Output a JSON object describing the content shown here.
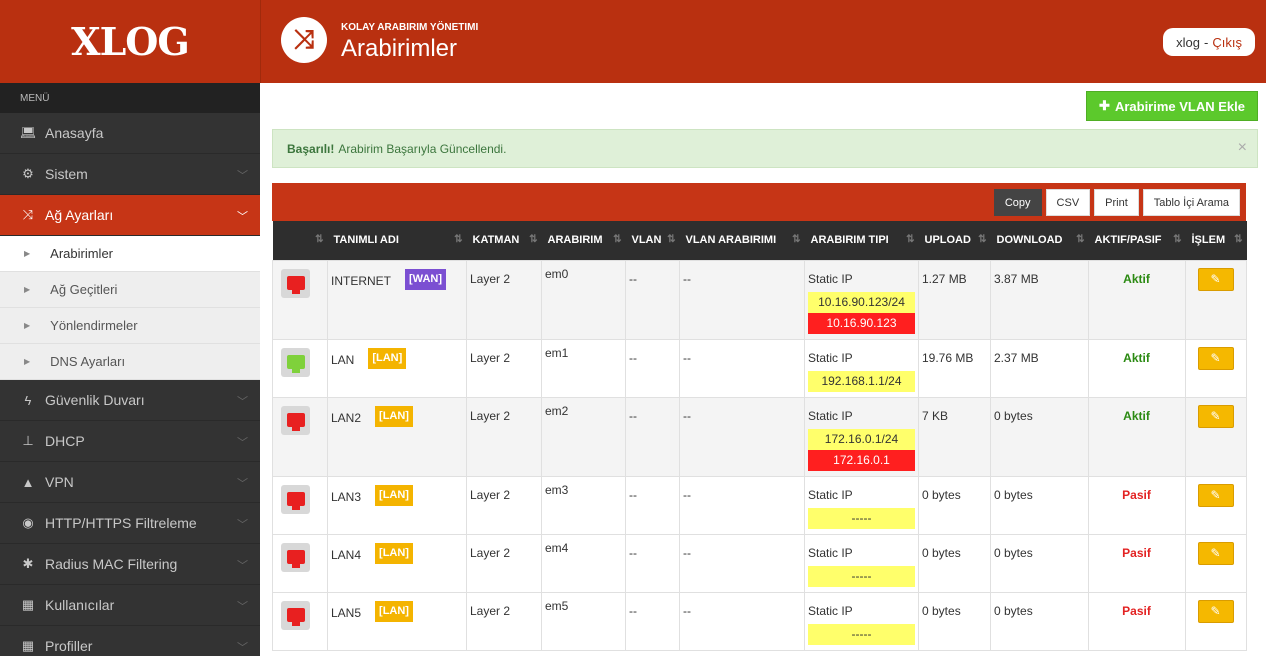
{
  "sidebar": {
    "logo": "XLOG",
    "menu_label": "MENÜ",
    "items": [
      {
        "label": "Anasayfa",
        "icon": "laptop-icon"
      },
      {
        "label": "Sistem",
        "icon": "cogs-icon"
      },
      {
        "label": "Ağ Ayarları",
        "icon": "shuffle-icon"
      },
      {
        "label": "Güvenlik Duvarı",
        "icon": "bolt-icon"
      },
      {
        "label": "DHCP",
        "icon": "sitemap-icon"
      },
      {
        "label": "VPN",
        "icon": "road-icon"
      },
      {
        "label": "HTTP/HTTPS Filtreleme",
        "icon": "eye-slash-icon"
      },
      {
        "label": "Radius MAC Filtering",
        "icon": "asterisk-icon"
      },
      {
        "label": "Kullanıcılar",
        "icon": "grid-icon"
      },
      {
        "label": "Profiller",
        "icon": "grid-icon"
      }
    ],
    "subitems": [
      {
        "label": "Arabirimler"
      },
      {
        "label": "Ağ Geçitleri"
      },
      {
        "label": "Yönlendirmeler"
      },
      {
        "label": "DNS Ayarları"
      }
    ]
  },
  "header": {
    "subtitle": "KOLAY ARABIRIM YÖNETIMI",
    "title": "Arabirimler",
    "user": "xlog",
    "separator": "-",
    "logout": "Çıkış"
  },
  "main": {
    "vlan_button": "Arabirime VLAN Ekle",
    "alert_strong": "Başarılı!",
    "alert_text": "Arabirim Başarıyla Güncellendi.",
    "alert_close": "×",
    "export_buttons": {
      "copy": "Copy",
      "csv": "CSV",
      "print": "Print",
      "search": "Tablo İçi Arama"
    }
  },
  "table": {
    "columns": {
      "name": "TANIMLI ADI",
      "layer": "KATMAN",
      "iface": "ARABIRIM",
      "vlan": "VLAN",
      "vlan_iface": "VLAN ARABIRIMI",
      "type": "ARABIRIM TIPI",
      "upload": "UPLOAD",
      "download": "DOWNLOAD",
      "state": "AKTIF/PASIF",
      "action": "İŞLEM"
    },
    "rows": [
      {
        "name": "INTERNET",
        "badge": "[WAN]",
        "layer": "Layer 2",
        "iface": "em0",
        "vlan": "--",
        "vlan_iface": "--",
        "type": "Static IP",
        "ip_yellow": "10.16.90.123/24",
        "ip_red": "10.16.90.123",
        "upload": "1.27 MB",
        "download": "3.87 MB",
        "state": "Aktif"
      },
      {
        "name": "LAN",
        "badge": "[LAN]",
        "layer": "Layer 2",
        "iface": "em1",
        "vlan": "--",
        "vlan_iface": "--",
        "type": "Static IP",
        "ip_yellow": "192.168.1.1/24",
        "upload": "19.76 MB",
        "download": "2.37 MB",
        "state": "Aktif"
      },
      {
        "name": "LAN2",
        "badge": "[LAN]",
        "layer": "Layer 2",
        "iface": "em2",
        "vlan": "--",
        "vlan_iface": "--",
        "type": "Static IP",
        "ip_yellow": "172.16.0.1/24",
        "ip_red": "172.16.0.1",
        "upload": "7 KB",
        "download": "0 bytes",
        "state": "Aktif"
      },
      {
        "name": "LAN3",
        "badge": "[LAN]",
        "layer": "Layer 2",
        "iface": "em3",
        "vlan": "--",
        "vlan_iface": "--",
        "type": "Static IP",
        "ip_yellow": "-----",
        "upload": "0 bytes",
        "download": "0 bytes",
        "state": "Pasif"
      },
      {
        "name": "LAN4",
        "badge": "[LAN]",
        "layer": "Layer 2",
        "iface": "em4",
        "vlan": "--",
        "vlan_iface": "--",
        "type": "Static IP",
        "ip_yellow": "-----",
        "upload": "0 bytes",
        "download": "0 bytes",
        "state": "Pasif"
      },
      {
        "name": "LAN5",
        "badge": "[LAN]",
        "layer": "Layer 2",
        "iface": "em5",
        "vlan": "--",
        "vlan_iface": "--",
        "type": "Static IP",
        "ip_yellow": "-----",
        "upload": "0 bytes",
        "download": "0 bytes",
        "state": "Pasif"
      }
    ]
  },
  "colors": {
    "brand": "#b93010",
    "active_green": "#2b8a12",
    "passive_red": "#e32222",
    "wan_badge": "#7b4fd2",
    "lan_badge": "#f4b400",
    "port_red": "#e82020",
    "port_green": "#7fd13b"
  }
}
